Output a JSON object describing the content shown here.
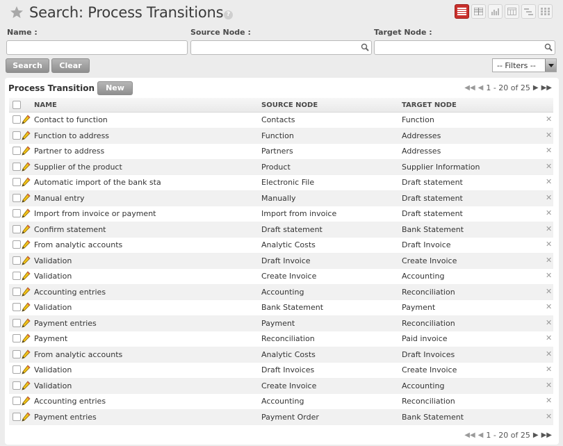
{
  "header": {
    "title": "Search: Process Transitions",
    "help": "?"
  },
  "views": [
    "list-view",
    "form-view",
    "graph-view",
    "calendar-view",
    "gantt-view",
    "grid-view"
  ],
  "search": {
    "fields": [
      {
        "label": "Name :",
        "value": ""
      },
      {
        "label": "Source Node :",
        "value": ""
      },
      {
        "label": "Target Node :",
        "value": ""
      }
    ],
    "search_label": "Search",
    "clear_label": "Clear",
    "filters_label": "-- Filters --"
  },
  "list": {
    "title": "Process Transition",
    "new_label": "New",
    "pager": "1 - 20 of 25",
    "columns": [
      "NAME",
      "SOURCE NODE",
      "TARGET NODE"
    ],
    "rows": [
      [
        "Contact to function",
        "Contacts",
        "Function"
      ],
      [
        "Function to address",
        "Function",
        "Addresses"
      ],
      [
        "Partner to address",
        "Partners",
        "Addresses"
      ],
      [
        "Supplier of the product",
        "Product",
        "Supplier Information"
      ],
      [
        "Automatic import of the bank sta",
        "Electronic File",
        "Draft statement"
      ],
      [
        "Manual entry",
        "Manually",
        "Draft statement"
      ],
      [
        "Import from invoice or payment",
        "Import from invoice",
        "Draft statement"
      ],
      [
        "Confirm statement",
        "Draft statement",
        "Bank Statement"
      ],
      [
        "From analytic accounts",
        "Analytic Costs",
        "Draft Invoice"
      ],
      [
        "Validation",
        "Draft Invoice",
        "Create Invoice"
      ],
      [
        "Validation",
        "Create Invoice",
        "Accounting"
      ],
      [
        "Accounting entries",
        "Accounting",
        "Reconciliation"
      ],
      [
        "Validation",
        "Bank Statement",
        "Payment"
      ],
      [
        "Payment entries",
        "Payment",
        "Reconciliation"
      ],
      [
        "Payment",
        "Reconciliation",
        "Paid invoice"
      ],
      [
        "From analytic accounts",
        "Analytic Costs",
        "Draft Invoices"
      ],
      [
        "Validation",
        "Draft Invoices",
        "Create Invoice"
      ],
      [
        "Validation",
        "Create Invoice",
        "Accounting"
      ],
      [
        "Accounting entries",
        "Accounting",
        "Reconciliation"
      ],
      [
        "Payment entries",
        "Payment Order",
        "Bank Statement"
      ]
    ]
  },
  "colors": {
    "accent": "#c9302c",
    "button": "#9a9a9a"
  }
}
